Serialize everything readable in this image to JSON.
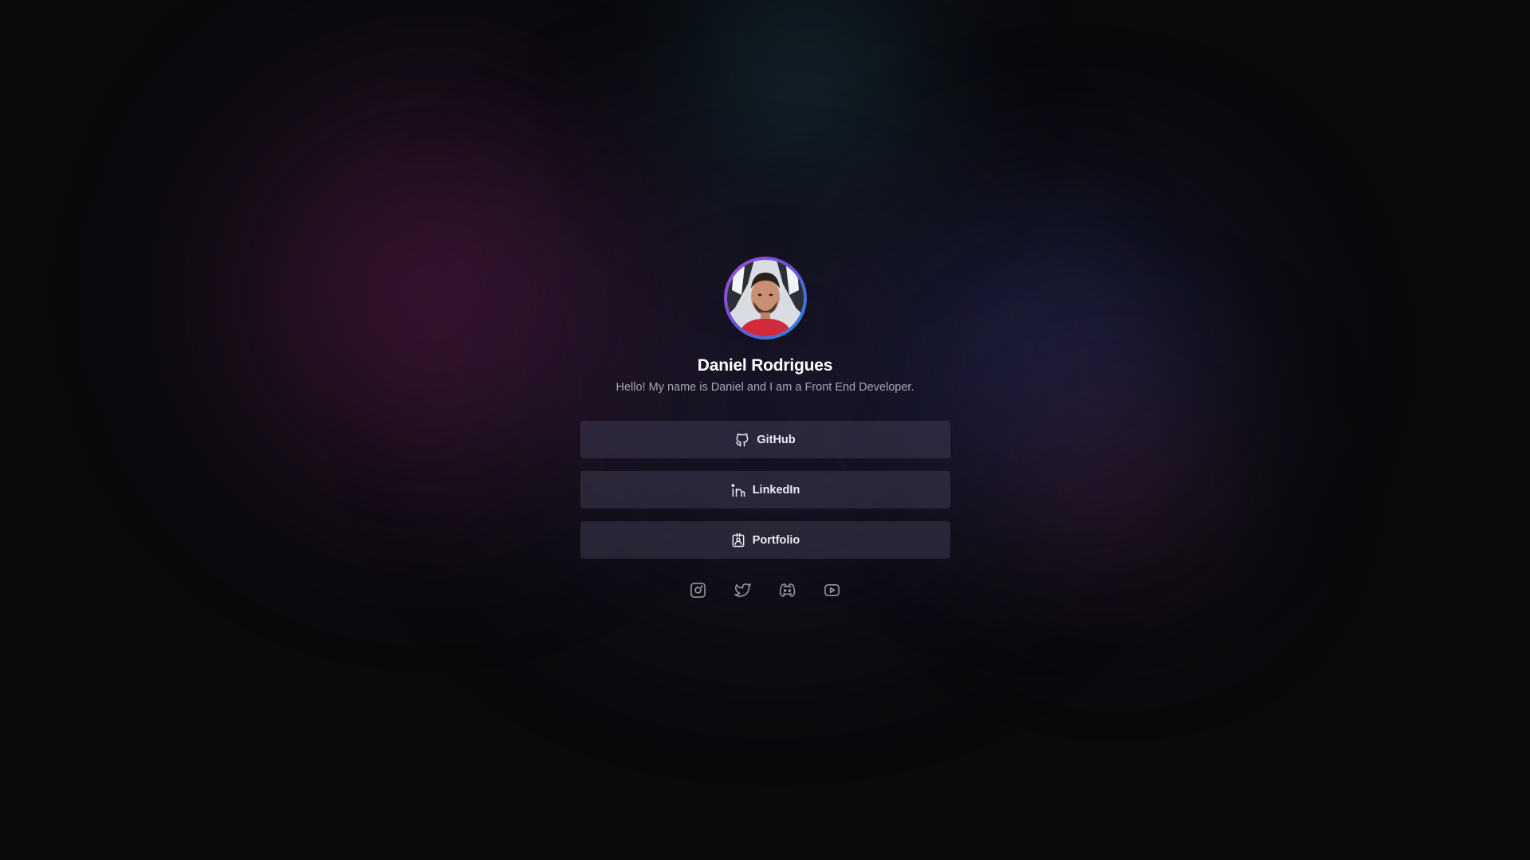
{
  "profile": {
    "name": "Daniel Rodrigues",
    "bio": "Hello! My name is Daniel and I am a Front End Developer."
  },
  "links": [
    {
      "label": "GitHub",
      "icon": "github-icon"
    },
    {
      "label": "LinkedIn",
      "icon": "linkedin-icon"
    },
    {
      "label": "Portfolio",
      "icon": "portfolio-icon"
    }
  ],
  "socials": [
    {
      "icon": "instagram-icon"
    },
    {
      "icon": "twitter-icon"
    },
    {
      "icon": "discord-icon"
    },
    {
      "icon": "youtube-icon"
    }
  ],
  "colors": {
    "background": "#0a0a0d",
    "button_bg": "#3a3650",
    "text_primary": "#ffffff",
    "text_secondary": "#a8a8b4",
    "icon_stroke": "#9c9cab",
    "avatar_ring_start": "#b04ad6",
    "avatar_ring_end": "#1d8fe0"
  }
}
